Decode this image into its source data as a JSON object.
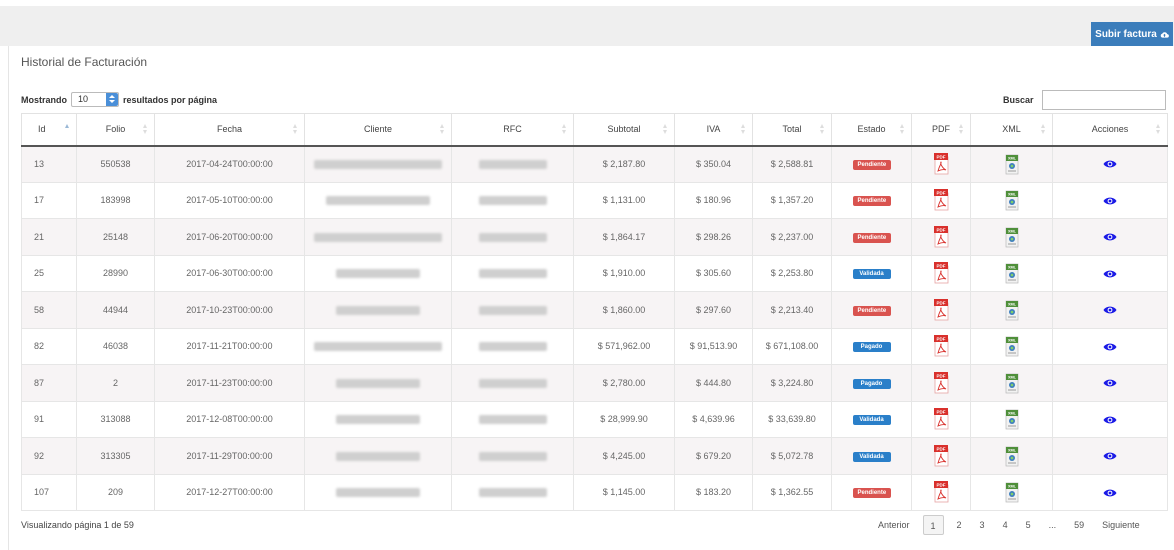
{
  "upload_button": {
    "label": "Subir factura"
  },
  "panel": {
    "title": "Historial de Facturación"
  },
  "length": {
    "prefix": "Mostrando",
    "value": "10",
    "suffix": "resultados por página"
  },
  "search": {
    "label": "Buscar",
    "value": ""
  },
  "columns": [
    "Id",
    "Folio",
    "Fecha",
    "Cliente",
    "RFC",
    "Subtotal",
    "IVA",
    "Total",
    "Estado",
    "PDF",
    "XML",
    "Acciones"
  ],
  "status_colors": {
    "Pendiente": "#d9534f",
    "Validada": "#2a7fc9",
    "Pagado": "#2a7fc9"
  },
  "rows": [
    {
      "id": "13",
      "folio": "550538",
      "fecha": "2017-04-24T00:00:00",
      "subtotal": "$ 2,187.80",
      "iva": "$ 350.04",
      "total": "$ 2,588.81",
      "estado": "Pendiente",
      "pdf_icon": "pdf-file-icon",
      "xml_icon": "xml-file-icon",
      "action_icon": "eye-icon"
    },
    {
      "id": "17",
      "folio": "183998",
      "fecha": "2017-05-10T00:00:00",
      "subtotal": "$ 1,131.00",
      "iva": "$ 180.96",
      "total": "$ 1,357.20",
      "estado": "Pendiente",
      "pdf_icon": "pdf-file-icon",
      "xml_icon": "xml-file-icon",
      "action_icon": "eye-icon"
    },
    {
      "id": "21",
      "folio": "25148",
      "fecha": "2017-06-20T00:00:00",
      "subtotal": "$ 1,864.17",
      "iva": "$ 298.26",
      "total": "$ 2,237.00",
      "estado": "Pendiente",
      "pdf_icon": "pdf-file-icon",
      "xml_icon": "xml-file-icon",
      "action_icon": "eye-icon"
    },
    {
      "id": "25",
      "folio": "28990",
      "fecha": "2017-06-30T00:00:00",
      "subtotal": "$ 1,910.00",
      "iva": "$ 305.60",
      "total": "$ 2,253.80",
      "estado": "Validada",
      "pdf_icon": "pdf-file-icon",
      "xml_icon": "xml-file-icon",
      "action_icon": "eye-icon"
    },
    {
      "id": "58",
      "folio": "44944",
      "fecha": "2017-10-23T00:00:00",
      "subtotal": "$ 1,860.00",
      "iva": "$ 297.60",
      "total": "$ 2,213.40",
      "estado": "Pendiente",
      "pdf_icon": "pdf-file-icon",
      "xml_icon": "xml-file-icon",
      "action_icon": "eye-icon"
    },
    {
      "id": "82",
      "folio": "46038",
      "fecha": "2017-11-21T00:00:00",
      "subtotal": "$ 571,962.00",
      "iva": "$ 91,513.90",
      "total": "$ 671,108.00",
      "estado": "Pagado",
      "pdf_icon": "pdf-file-icon",
      "xml_icon": "xml-file-icon",
      "action_icon": "eye-icon"
    },
    {
      "id": "87",
      "folio": "2",
      "fecha": "2017-11-23T00:00:00",
      "subtotal": "$ 2,780.00",
      "iva": "$ 444.80",
      "total": "$ 3,224.80",
      "estado": "Pagado",
      "pdf_icon": "pdf-file-icon",
      "xml_icon": "xml-file-icon",
      "action_icon": "eye-icon"
    },
    {
      "id": "91",
      "folio": "313088",
      "fecha": "2017-12-08T00:00:00",
      "subtotal": "$ 28,999.90",
      "iva": "$ 4,639.96",
      "total": "$ 33,639.80",
      "estado": "Validada",
      "pdf_icon": "pdf-file-icon",
      "xml_icon": "xml-file-icon",
      "action_icon": "eye-icon"
    },
    {
      "id": "92",
      "folio": "313305",
      "fecha": "2017-11-29T00:00:00",
      "subtotal": "$ 4,245.00",
      "iva": "$ 679.20",
      "total": "$ 5,072.78",
      "estado": "Validada",
      "pdf_icon": "pdf-file-icon",
      "xml_icon": "xml-file-icon",
      "action_icon": "eye-icon"
    },
    {
      "id": "107",
      "folio": "209",
      "fecha": "2017-12-27T00:00:00",
      "subtotal": "$ 1,145.00",
      "iva": "$ 183.20",
      "total": "$ 1,362.55",
      "estado": "Pendiente",
      "pdf_icon": "pdf-file-icon",
      "xml_icon": "xml-file-icon",
      "action_icon": "eye-icon"
    }
  ],
  "footer": {
    "info": "Visualizando página 1 de 59"
  },
  "pagination": {
    "previous": "Anterior",
    "pages": [
      "1",
      "2",
      "3",
      "4",
      "5",
      "...",
      "59"
    ],
    "current": "1",
    "next": "Siguiente"
  }
}
